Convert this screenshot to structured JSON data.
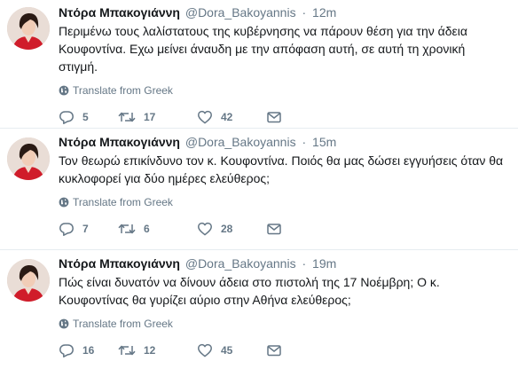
{
  "tweets": [
    {
      "author": "Ντόρα Μπακογιάννη",
      "handle": "@Dora_Bakoyannis",
      "separator": "·",
      "time": "12m",
      "text": "Περιμένω τους λαλίστατους της κυβέρνησης να πάρουν θέση για την άδεια Κουφοντίνα. Εχω μείνει άναυδη με την απόφαση αυτή, σε αυτή τη χρονική στιγμή.",
      "translate_label": "Translate from Greek",
      "replies": "5",
      "retweets": "17",
      "likes": "42"
    },
    {
      "author": "Ντόρα Μπακογιάννη",
      "handle": "@Dora_Bakoyannis",
      "separator": "·",
      "time": "15m",
      "text": "Τον θεωρώ επικίνδυνο τον κ. Κουφοντίνα. Ποιός θα μας δώσει εγγυήσεις όταν θα κυκλοφορεί για δύο ημέρες ελεύθερος;",
      "translate_label": "Translate from Greek",
      "replies": "7",
      "retweets": "6",
      "likes": "28"
    },
    {
      "author": "Ντόρα Μπακογιάννη",
      "handle": "@Dora_Bakoyannis",
      "separator": "·",
      "time": "19m",
      "text": "Πώς είναι δυνατόν να δίνουν άδεια στο πιστολή της 17 Νοέμβρη; Ο κ. Κουφοντίνας θα γυρίζει αύριο στην Αθήνα ελεύθερος;",
      "translate_label": "Translate from Greek",
      "replies": "16",
      "retweets": "12",
      "likes": "45"
    }
  ],
  "icons": {
    "reply": "reply-icon",
    "retweet": "retweet-icon",
    "like": "heart-icon",
    "dm": "envelope-icon",
    "translate": "globe-icon"
  },
  "colors": {
    "name": "#14171a",
    "muted": "#657786",
    "divider": "#e6ecf0",
    "avatar_jacket": "#d01c2a"
  }
}
